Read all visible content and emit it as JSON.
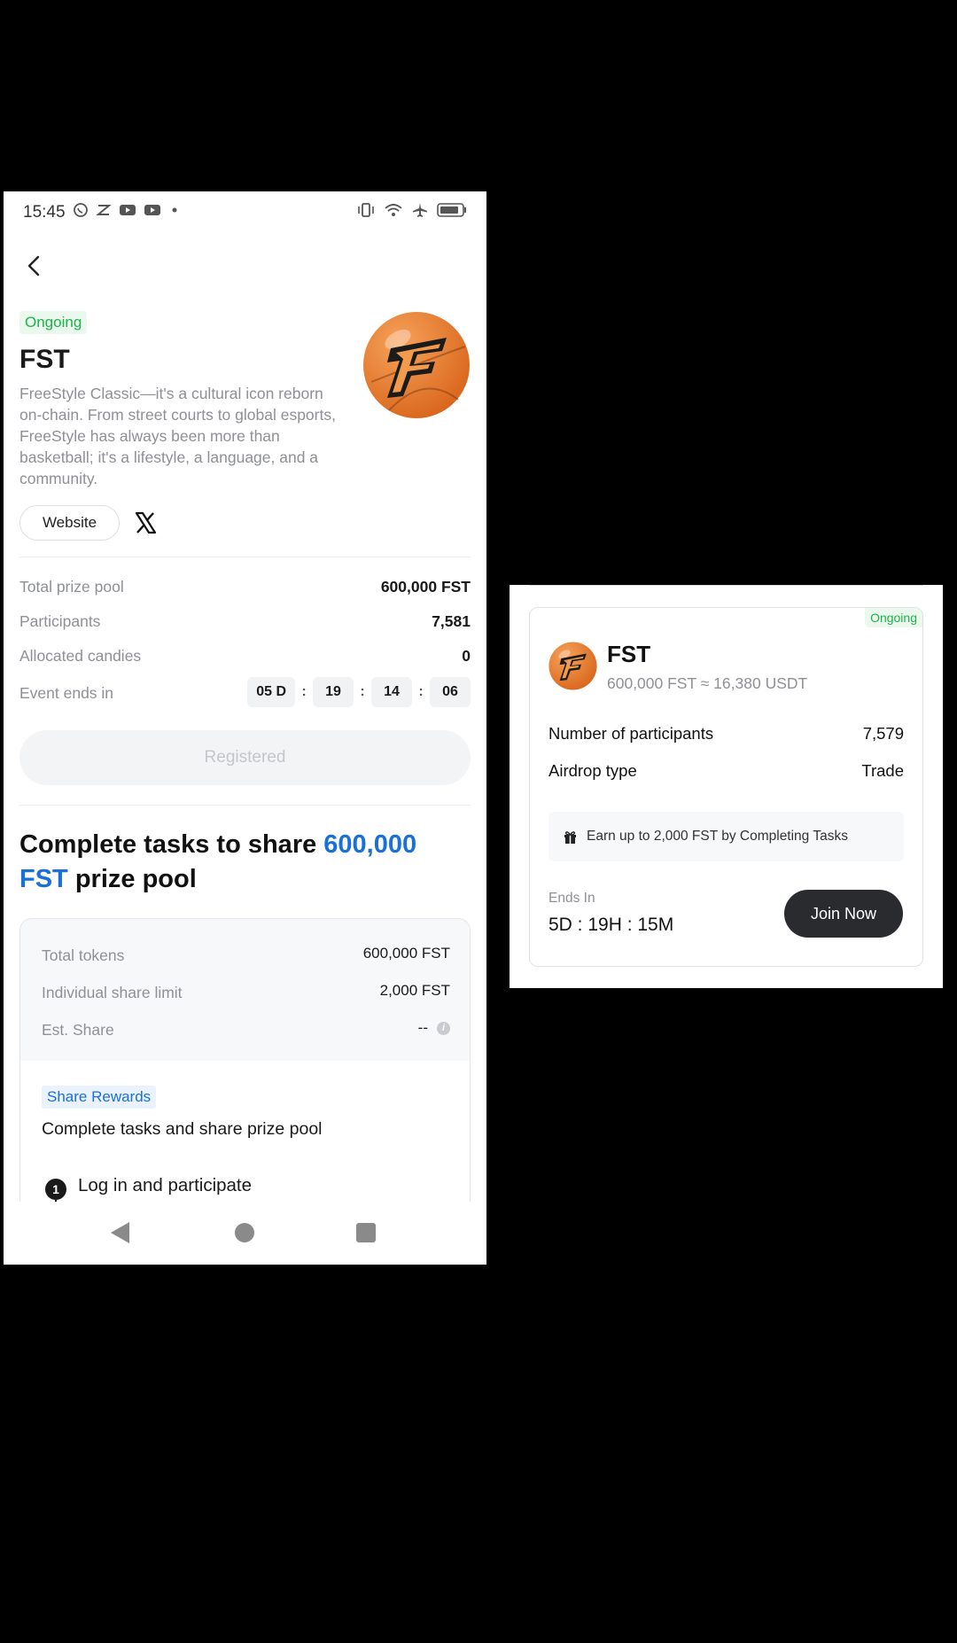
{
  "status_bar": {
    "time": "15:45",
    "left_icons": [
      "whatsapp-icon",
      "capcut-icon",
      "youtube-icon",
      "youtube-icon",
      "dot-icon"
    ],
    "right_icons": [
      "vibrate-icon",
      "wifi-icon",
      "airplane-icon",
      "battery-icon"
    ]
  },
  "project": {
    "status": "Ongoing",
    "title": "FST",
    "description": "FreeStyle Classic—it's a cultural icon reborn on-chain. From street courts to global esports, FreeStyle has always been more than basketball; it's a lifestyle, a language, and a community.",
    "website_label": "Website",
    "social_icon": "x-icon"
  },
  "stats": {
    "total_prize_pool_label": "Total prize pool",
    "total_prize_pool_value": "600,000 FST",
    "participants_label": "Participants",
    "participants_value": "7,581",
    "allocated_label": "Allocated candies",
    "allocated_value": "0",
    "event_ends_label": "Event ends in",
    "timer": {
      "days": "05 D",
      "hours": "19",
      "minutes": "14",
      "seconds": "06",
      "sep": ":"
    }
  },
  "registered_button": "Registered",
  "heading": {
    "part1": "Complete tasks to share ",
    "highlight": "600,000 FST",
    "part2": " prize pool"
  },
  "pool": {
    "total_tokens_label": "Total tokens",
    "total_tokens_value": "600,000 FST",
    "share_limit_label": "Individual share limit",
    "share_limit_value": "2,000 FST",
    "est_share_label": "Est. Share",
    "est_share_value": "--",
    "share_rewards_badge": "Share Rewards",
    "share_rewards_subtitle": "Complete tasks and share prize pool",
    "step_number": "1",
    "step_text": "Log in and participate"
  },
  "card": {
    "status": "Ongoing",
    "title": "FST",
    "subtitle": "600,000 FST ≈ 16,380 USDT",
    "participants_label": "Number of participants",
    "participants_value": "7,579",
    "airdrop_label": "Airdrop type",
    "airdrop_value": "Trade",
    "promo_text": "Earn up to 2,000 FST by Completing Tasks",
    "ends_label": "Ends In",
    "ends_value": "5D : 19H : 15M",
    "join_button": "Join Now"
  },
  "colors": {
    "accent_blue": "#1b6fd8",
    "ongoing_green": "#1fb24a",
    "logo_orange": "#e8822c"
  }
}
